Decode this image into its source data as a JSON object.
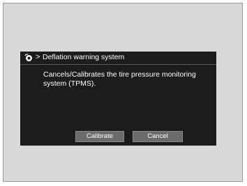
{
  "header": {
    "icon": "settings-icon",
    "title": "Deflation warning system"
  },
  "message": "Cancels/Calibrates the tire pressure monitoring system (TPMS).",
  "buttons": {
    "calibrate_label": "Calibrate",
    "cancel_label": "Cancel"
  },
  "colors": {
    "screen_bg": "#1c1c1c",
    "frame_bg": "#d9d9d9",
    "button_bg": "#6b6b6b",
    "text": "#ffffff"
  }
}
